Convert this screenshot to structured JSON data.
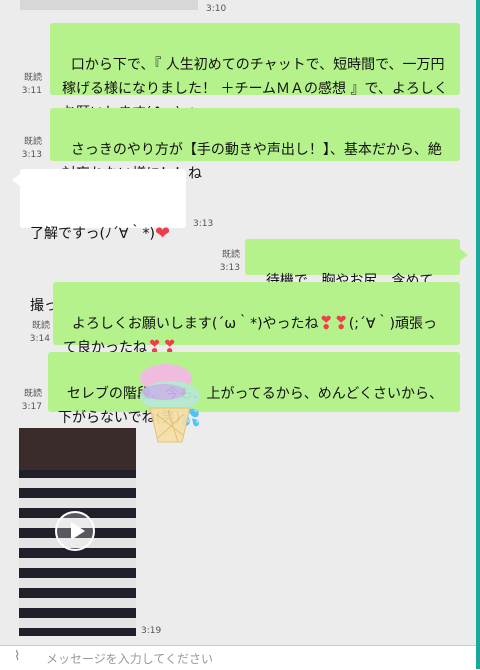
{
  "prev_message": {
    "time": "3:10"
  },
  "messages": [
    {
      "id": "m1",
      "read": "既読",
      "time": "3:11",
      "text": "口から下で、『 人生初めてのチャットで、短時間で、一万円稼げる様になりました！ ＋チームＭＡの感想 』で、よろしくお願いします(^_-)-☆"
    },
    {
      "id": "m2",
      "read": "既読",
      "time": "3:13",
      "text": "さっきのやり方が【手の動きや声出し！】、基本だから、絶対忘れない様に！！ね"
    },
    {
      "id": "m3",
      "time": "3:13",
      "line1": "了解ですっ(ﾉ´∀｀*)",
      "line2": "撮ってきます！"
    },
    {
      "id": "m4",
      "read": "既読",
      "time": "3:13",
      "text": "待機で、胸やお尻、含めてね！！"
    },
    {
      "id": "m5",
      "read": "既読",
      "time": "3:14",
      "part1": "よろしくお願いします(´ω｀*)やったね",
      "part2": "(;´∀｀)頑張って良かったね"
    },
    {
      "id": "m6",
      "read": "既読",
      "time": "3:17",
      "text": "セレブの階段、今も、上がってるから、めんどくさいから、下がらないでね(笑)"
    }
  ],
  "video": {
    "time": "3:19"
  },
  "input": {
    "placeholder": "メッセージを入力してください"
  },
  "icons": {
    "heart": "heart-icon",
    "sweat": "sweat-drops-icon",
    "play": "play-icon",
    "attach": "paperclip-icon"
  },
  "colors": {
    "outgoing_bubble": "#b5f28c",
    "incoming_bubble": "#ffffff",
    "background": "#ececec"
  }
}
